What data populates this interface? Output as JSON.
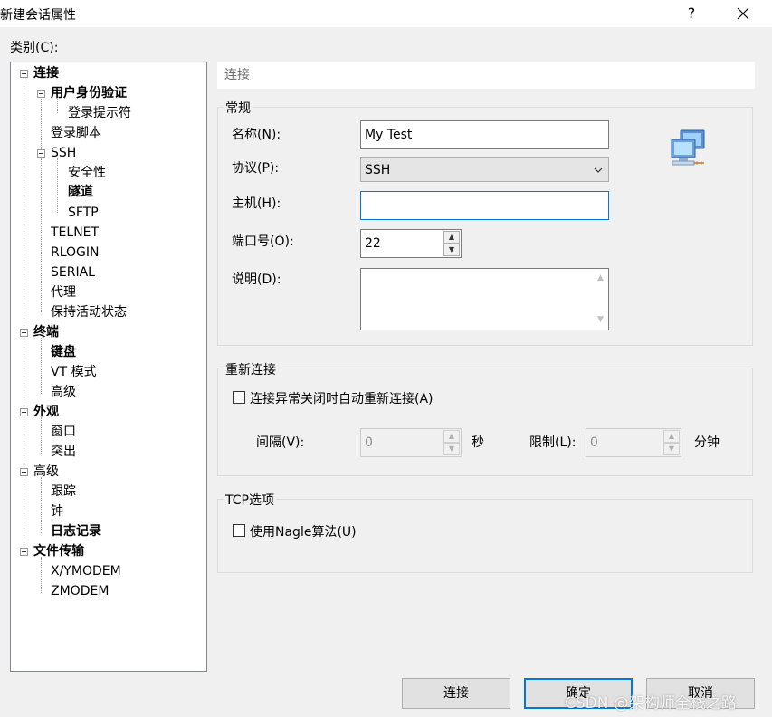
{
  "window": {
    "title": "新建会话属性",
    "help": "?",
    "close": "✕"
  },
  "category_label": "类别(C):",
  "tree": {
    "connection": "连接",
    "user_auth": "用户身份验证",
    "login_prompt": "登录提示符",
    "login_script": "登录脚本",
    "ssh": "SSH",
    "security": "安全性",
    "tunnel": "隧道",
    "sftp": "SFTP",
    "telnet": "TELNET",
    "rlogin": "RLOGIN",
    "serial": "SERIAL",
    "proxy": "代理",
    "keepalive": "保持活动状态",
    "terminal": "终端",
    "keyboard": "键盘",
    "vt_mode": "VT 模式",
    "advanced": "高级",
    "appearance": "外观",
    "window": "窗口",
    "highlight": "突出",
    "advanced2": "高级",
    "trace": "跟踪",
    "bell": "钟",
    "logging": "日志记录",
    "file_transfer": "文件传输",
    "xymodem": "X/YMODEM",
    "zmodem": "ZMODEM"
  },
  "panel": {
    "header": "连接",
    "general": {
      "title": "常规",
      "name_label": "名称(N):",
      "name_value": "My Test",
      "protocol_label": "协议(P):",
      "protocol_value": "SSH",
      "host_label": "主机(H):",
      "host_value": "",
      "port_label": "端口号(O):",
      "port_value": "22",
      "desc_label": "说明(D):",
      "desc_value": "",
      "icon": "network-computers-icon"
    },
    "reconnect": {
      "title": "重新连接",
      "auto_label": "连接异常关闭时自动重新连接(A)",
      "auto_checked": false,
      "interval_label": "间隔(V):",
      "interval_value": "0",
      "interval_unit": "秒",
      "limit_label": "限制(L):",
      "limit_value": "0",
      "limit_unit": "分钟"
    },
    "tcp": {
      "title": "TCP选项",
      "nagle_label": "使用Nagle算法(U)",
      "nagle_checked": false
    }
  },
  "buttons": {
    "connect": "连接",
    "ok": "确定",
    "cancel": "取消"
  },
  "watermark": "CSDN @架构师全栈之路",
  "colors": {
    "focus_border": "#0078d7",
    "window_bg": "#f0f0f0"
  }
}
